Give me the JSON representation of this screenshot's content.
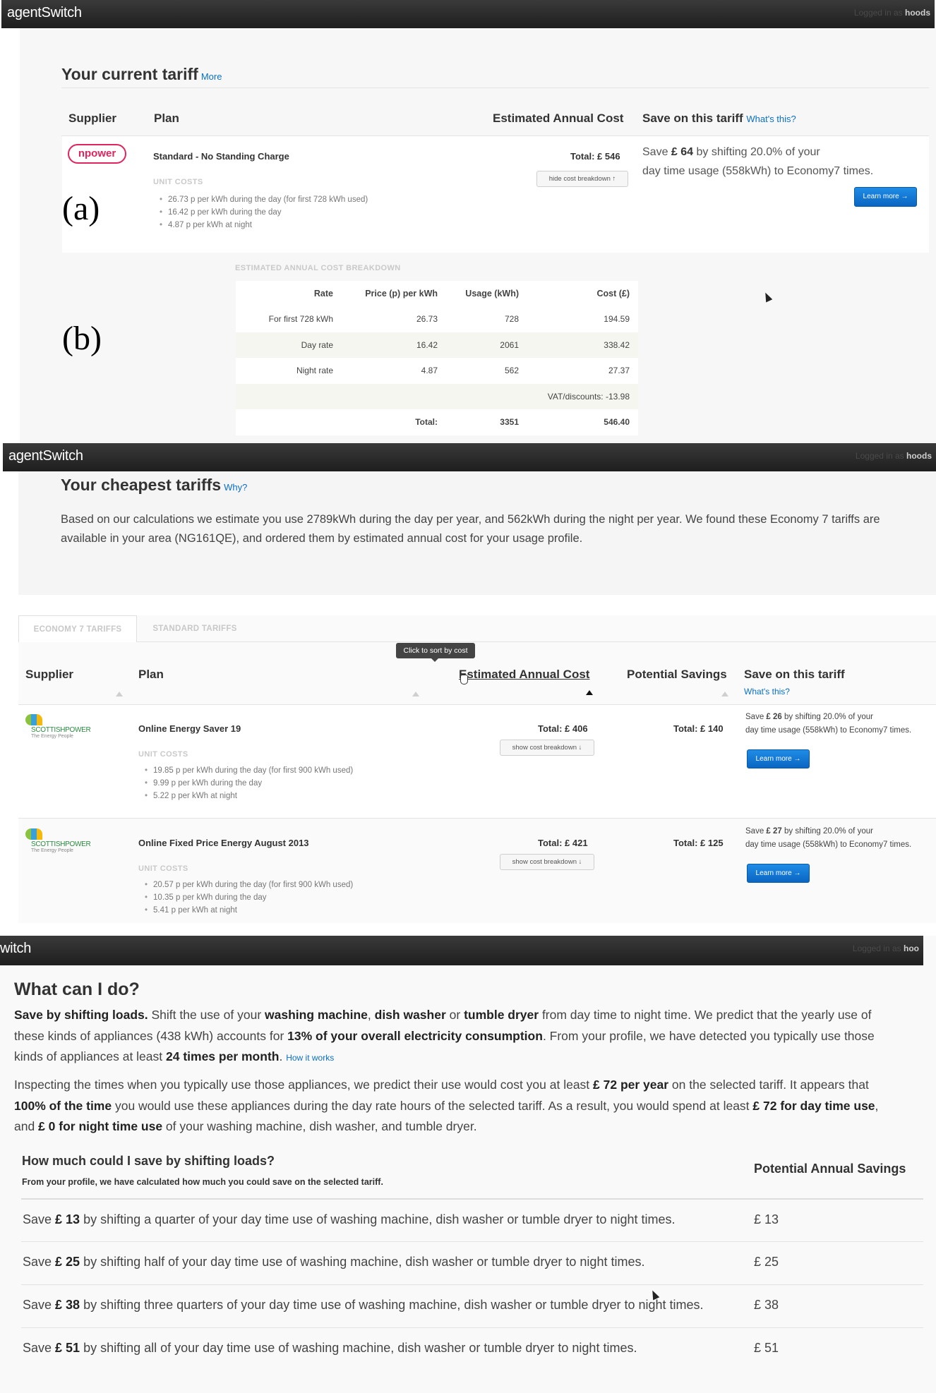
{
  "panel1": {
    "brand": "agentSwitch",
    "login_text": "Logged in as",
    "login_user": "hoods",
    "title": "Your current tariff",
    "title_link": "More",
    "columns": {
      "supplier": "Supplier",
      "plan": "Plan",
      "cost": "Estimated Annual Cost",
      "save": "Save on this tariff",
      "save_link": "What's this?"
    },
    "supplier_logo": "npower",
    "plan_name": "Standard - No Standing Charge",
    "unit_costs_label": "UNIT COSTS",
    "unit_costs": [
      "26.73 p per kWh during the day (for first 728 kWh used)",
      "16.42 p per kWh during the day",
      "4.87 p per kWh at night"
    ],
    "total": "Total: £ 546",
    "hide_button": "hide cost breakdown ↑",
    "save_pre": "Save ",
    "save_amount": "£ 64",
    "save_post": " by shifting 20.0% of your",
    "save_line2": "day time usage (558kWh) to Economy7 times.",
    "learn_more": "Learn more →",
    "label_a": "(a)",
    "label_b": "(b)",
    "breakdown_title": "ESTIMATED ANNUAL COST BREAKDOWN",
    "breakdown_headers": [
      "Rate",
      "Price (p) per kWh",
      "Usage (kWh)",
      "Cost (£)"
    ],
    "breakdown_rows": [
      [
        "For first 728 kWh",
        "26.73",
        "728",
        "194.59"
      ],
      [
        "Day rate",
        "16.42",
        "2061",
        "338.42"
      ],
      [
        "Night rate",
        "4.87",
        "562",
        "27.37"
      ],
      [
        "",
        "",
        "",
        "VAT/discounts: -13.98"
      ],
      [
        "",
        "Total:",
        "3351",
        "546.40"
      ]
    ]
  },
  "panel2": {
    "brand": "agentSwitch",
    "login_text": "Logged in as",
    "login_user": "hoods",
    "title": "Your cheapest tariffs",
    "title_link": "Why?",
    "intro": "Based on our calculations we estimate you use 2789kWh during the day per year, and 562kWh during the night per year. We found these Economy 7 tariffs are available in your area (NG161QE), and ordered them by estimated annual cost for your usage profile.",
    "tabs": [
      "ECONOMY 7 TARIFFS",
      "STANDARD TARIFFS"
    ],
    "tooltip": "Click to sort by cost",
    "columns": {
      "supplier": "Supplier",
      "plan": "Plan",
      "cost": "Estimated Annual Cost",
      "savings": "Potential Savings",
      "save": "Save on this tariff",
      "save_link": "What's this?"
    },
    "rows": [
      {
        "supplier": "SCOTTISHPOWER",
        "tagline": "The Energy People",
        "plan": "Online Energy Saver 19",
        "unit_costs_label": "UNIT COSTS",
        "unit_costs": [
          "19.85 p per kWh during the day (for first 900 kWh used)",
          "9.99 p per kWh during the day",
          "5.22 p per kWh at night"
        ],
        "total": "Total: £ 406",
        "show_button": "show cost breakdown ↓",
        "savings": "Total: £ 140",
        "save_pre": "Save ",
        "save_amount": "£ 26",
        "save_post": " by shifting 20.0% of your",
        "save_line2": "day time usage (558kWh) to Economy7 times.",
        "learn_more": "Learn more →"
      },
      {
        "supplier": "SCOTTISHPOWER",
        "tagline": "The Energy People",
        "plan": "Online Fixed Price Energy August 2013",
        "unit_costs_label": "UNIT COSTS",
        "unit_costs": [
          "20.57 p per kWh during the day (for first 900 kWh used)",
          "10.35 p per kWh during the day",
          "5.41 p per kWh at night"
        ],
        "total": "Total: £ 421",
        "show_button": "show cost breakdown ↓",
        "savings": "Total: £ 125",
        "save_pre": "Save ",
        "save_amount": "£ 27",
        "save_post": " by shifting 20.0% of your",
        "save_line2": "day time usage (558kWh) to Economy7 times.",
        "learn_more": "Learn more →"
      }
    ]
  },
  "panel3": {
    "brand": "witch",
    "login_text": "Logged in as",
    "login_user": "hoo",
    "title": "What can I do?",
    "p1_lead": "Save by shifting loads.",
    "p1_a": " Shift the use of your ",
    "p1_wm": "washing machine",
    "p1_b": ", ",
    "p1_dw": "dish washer",
    "p1_c": " or ",
    "p1_td": "tumble dryer",
    "p1_d": " from day time to night time. We predict that the yearly use of",
    "p1_line2_a": "these kinds of appliances (438 kWh) accounts for ",
    "p1_line2_b": "13% of your overall electricity consumption",
    "p1_line2_c": ". From your profile, we have detected you typically use those",
    "p1_line3_a": "kinds of appliances at least ",
    "p1_line3_b": "24 times per month",
    "p1_line3_c": ".",
    "p1_link": "How it works",
    "p2_line1_a": "Inspecting the times when you typically use those appliances, we predict their use would cost you at least ",
    "p2_line1_b": "£ 72 per year",
    "p2_line1_c": " on the selected tariff. It appears that",
    "p2_line2_a": "100% of the time",
    "p2_line2_b": " you would use these appliances during the day rate hours of the selected tariff. As a result, you would spend at least ",
    "p2_line2_c": "£ 72 for day time use",
    "p2_line2_d": ",",
    "p2_line3_a": "and ",
    "p2_line3_b": "£ 0 for night time use",
    "p2_line3_c": " of your washing machine, dish washer, and tumble dryer.",
    "table_heading": "How much could I save by shifting loads?",
    "table_sub": "From your profile, we have calculated how much you could save on the selected tariff.",
    "table_col2": "Potential Annual Savings",
    "rows": [
      {
        "pre": "Save ",
        "amount": "£ 13",
        "post": " by shifting a quarter of your day time use of washing machine, dish washer or tumble dryer to night times.",
        "value": "£ 13"
      },
      {
        "pre": "Save ",
        "amount": "£ 25",
        "post": " by shifting half of your day time use of washing machine, dish washer or tumble dryer to night times.",
        "value": "£ 25"
      },
      {
        "pre": "Save ",
        "amount": "£ 38",
        "post": " by shifting three quarters of your day time use of washing machine, dish washer or tumble dryer to night times.",
        "value": "£ 38"
      },
      {
        "pre": "Save ",
        "amount": "£ 51",
        "post": " by shifting all of your day time use of washing machine, dish washer or tumble dryer to night times.",
        "value": "£ 51"
      }
    ]
  }
}
